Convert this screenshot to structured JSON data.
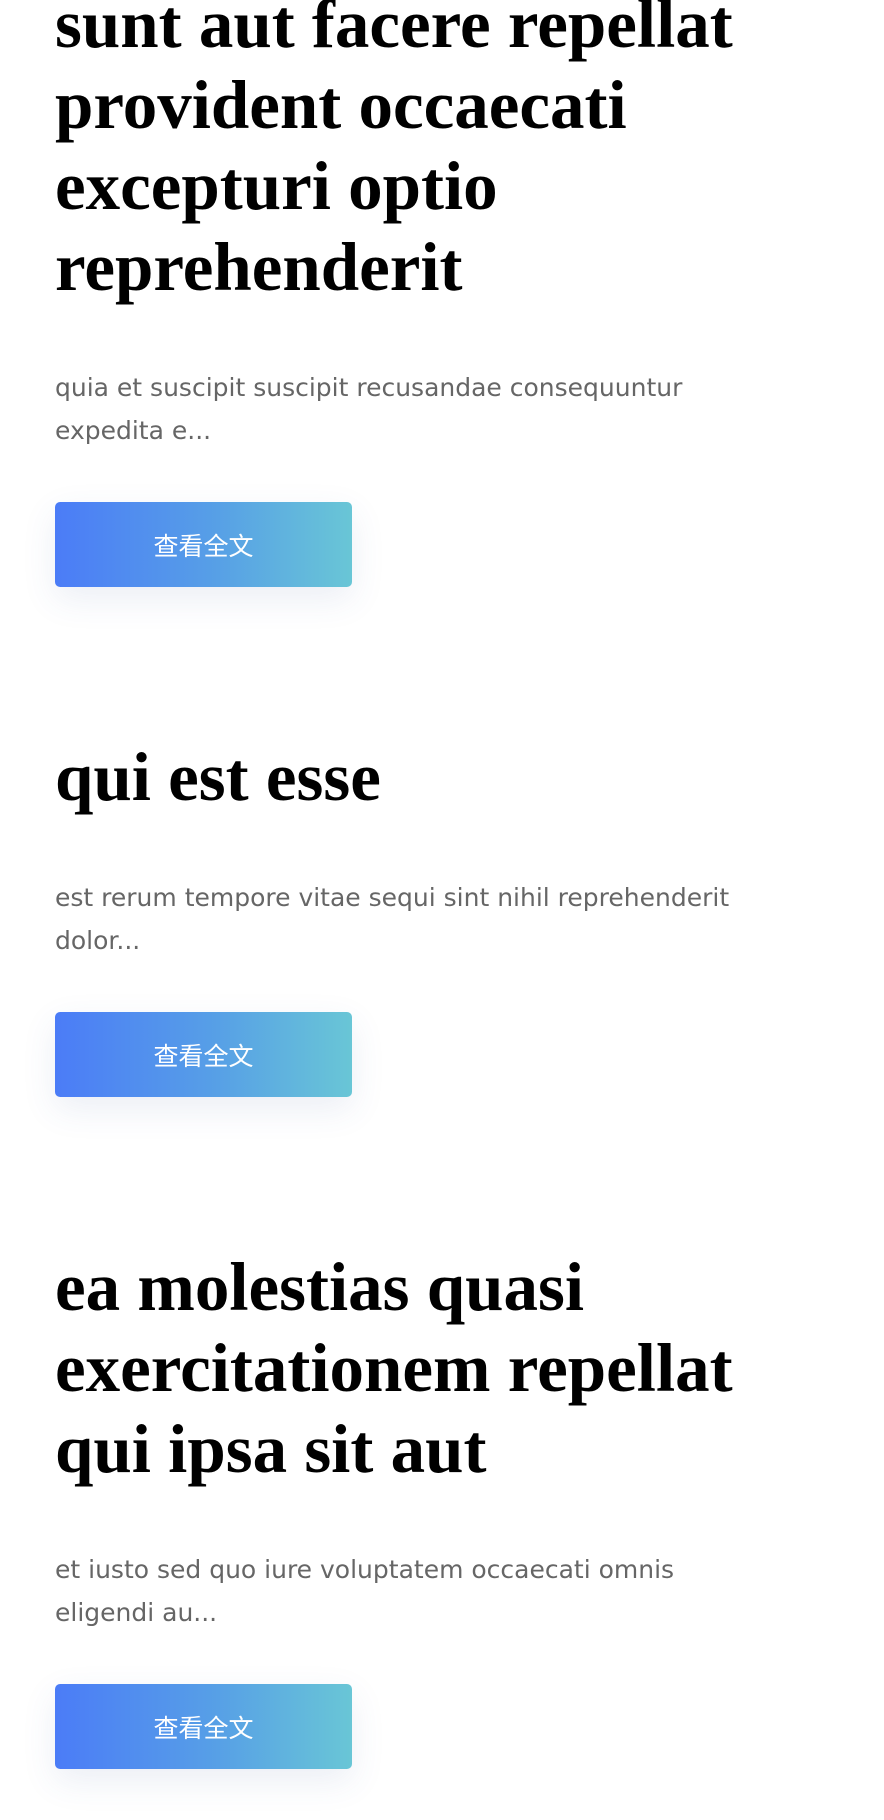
{
  "posts": [
    {
      "title": "sunt aut facere repellat provident occaecati excepturi optio reprehenderit",
      "excerpt": "quia et suscipit suscipit recusandae consequuntur expedita e...",
      "button_label": "查看全文"
    },
    {
      "title": "qui est esse",
      "excerpt": "est rerum tempore vitae sequi sint nihil reprehenderit dolor...",
      "button_label": "查看全文"
    },
    {
      "title": "ea molestias quasi exercitationem repellat qui ipsa sit aut",
      "excerpt": "et iusto sed quo iure voluptatem occaecati omnis eligendi au...",
      "button_label": "查看全文"
    }
  ],
  "colors": {
    "title": "#000000",
    "excerpt": "#666666",
    "button_gradient_start": "#4b7cf7",
    "button_gradient_end": "#69c6d6",
    "button_text": "#ffffff"
  }
}
